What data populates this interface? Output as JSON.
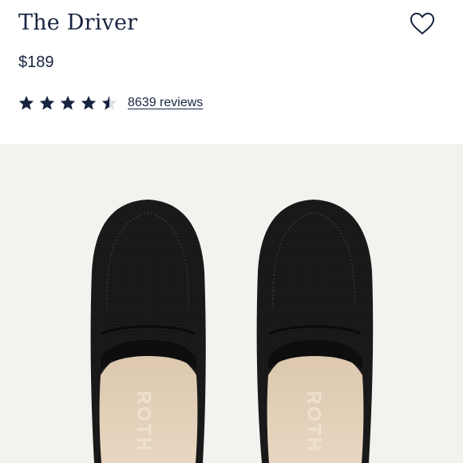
{
  "product": {
    "title": "The Driver",
    "price": "$189",
    "rating": {
      "value": 4.5,
      "max": 5,
      "reviews_label": "8639 reviews",
      "star_color": "#17233f"
    }
  },
  "favorite": {
    "icon": "heart-icon"
  },
  "image": {
    "subject": "black knit driving loafers",
    "insole_brand": "ROTH",
    "background_color": "#f4f2ef"
  }
}
